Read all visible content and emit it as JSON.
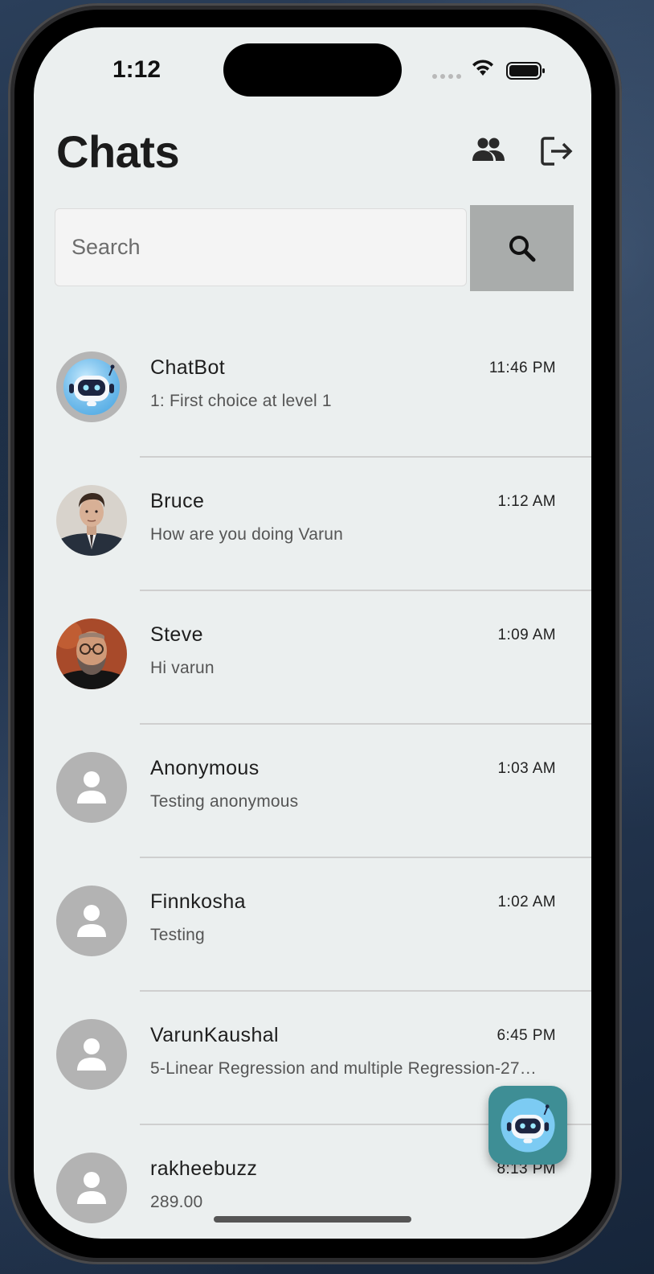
{
  "status": {
    "time": "1:12"
  },
  "header": {
    "title": "Chats",
    "contacts_icon": "people-icon",
    "logout_icon": "logout-icon"
  },
  "search": {
    "placeholder": "Search",
    "value": "",
    "icon": "search-icon"
  },
  "chats": [
    {
      "name": "ChatBot",
      "message": "1: First choice at level 1",
      "time": "11:46 PM",
      "avatar": "chatbot"
    },
    {
      "name": "Bruce",
      "message": "How are you doing Varun",
      "time": "1:12 AM",
      "avatar": "photo-bruce"
    },
    {
      "name": "Steve",
      "message": "Hi varun",
      "time": "1:09 AM",
      "avatar": "photo-steve"
    },
    {
      "name": "Anonymous",
      "message": "Testing anonymous",
      "time": "1:03 AM",
      "avatar": "default"
    },
    {
      "name": "Finnkosha",
      "message": "Testing",
      "time": "1:02 AM",
      "avatar": "default"
    },
    {
      "name": "VarunKaushal",
      "message": "5-Linear Regression and multiple Regression-27…",
      "time": "6:45 PM",
      "avatar": "default"
    },
    {
      "name": "rakheebuzz",
      "message": "289.00",
      "time": "8:13 PM",
      "avatar": "default"
    }
  ],
  "fab": {
    "icon": "chatbot-icon"
  },
  "colors": {
    "screen_bg": "#ebefef",
    "search_button": "#a9acab",
    "fab": "#3e8e95",
    "avatar_default": "#b3b3b3"
  }
}
